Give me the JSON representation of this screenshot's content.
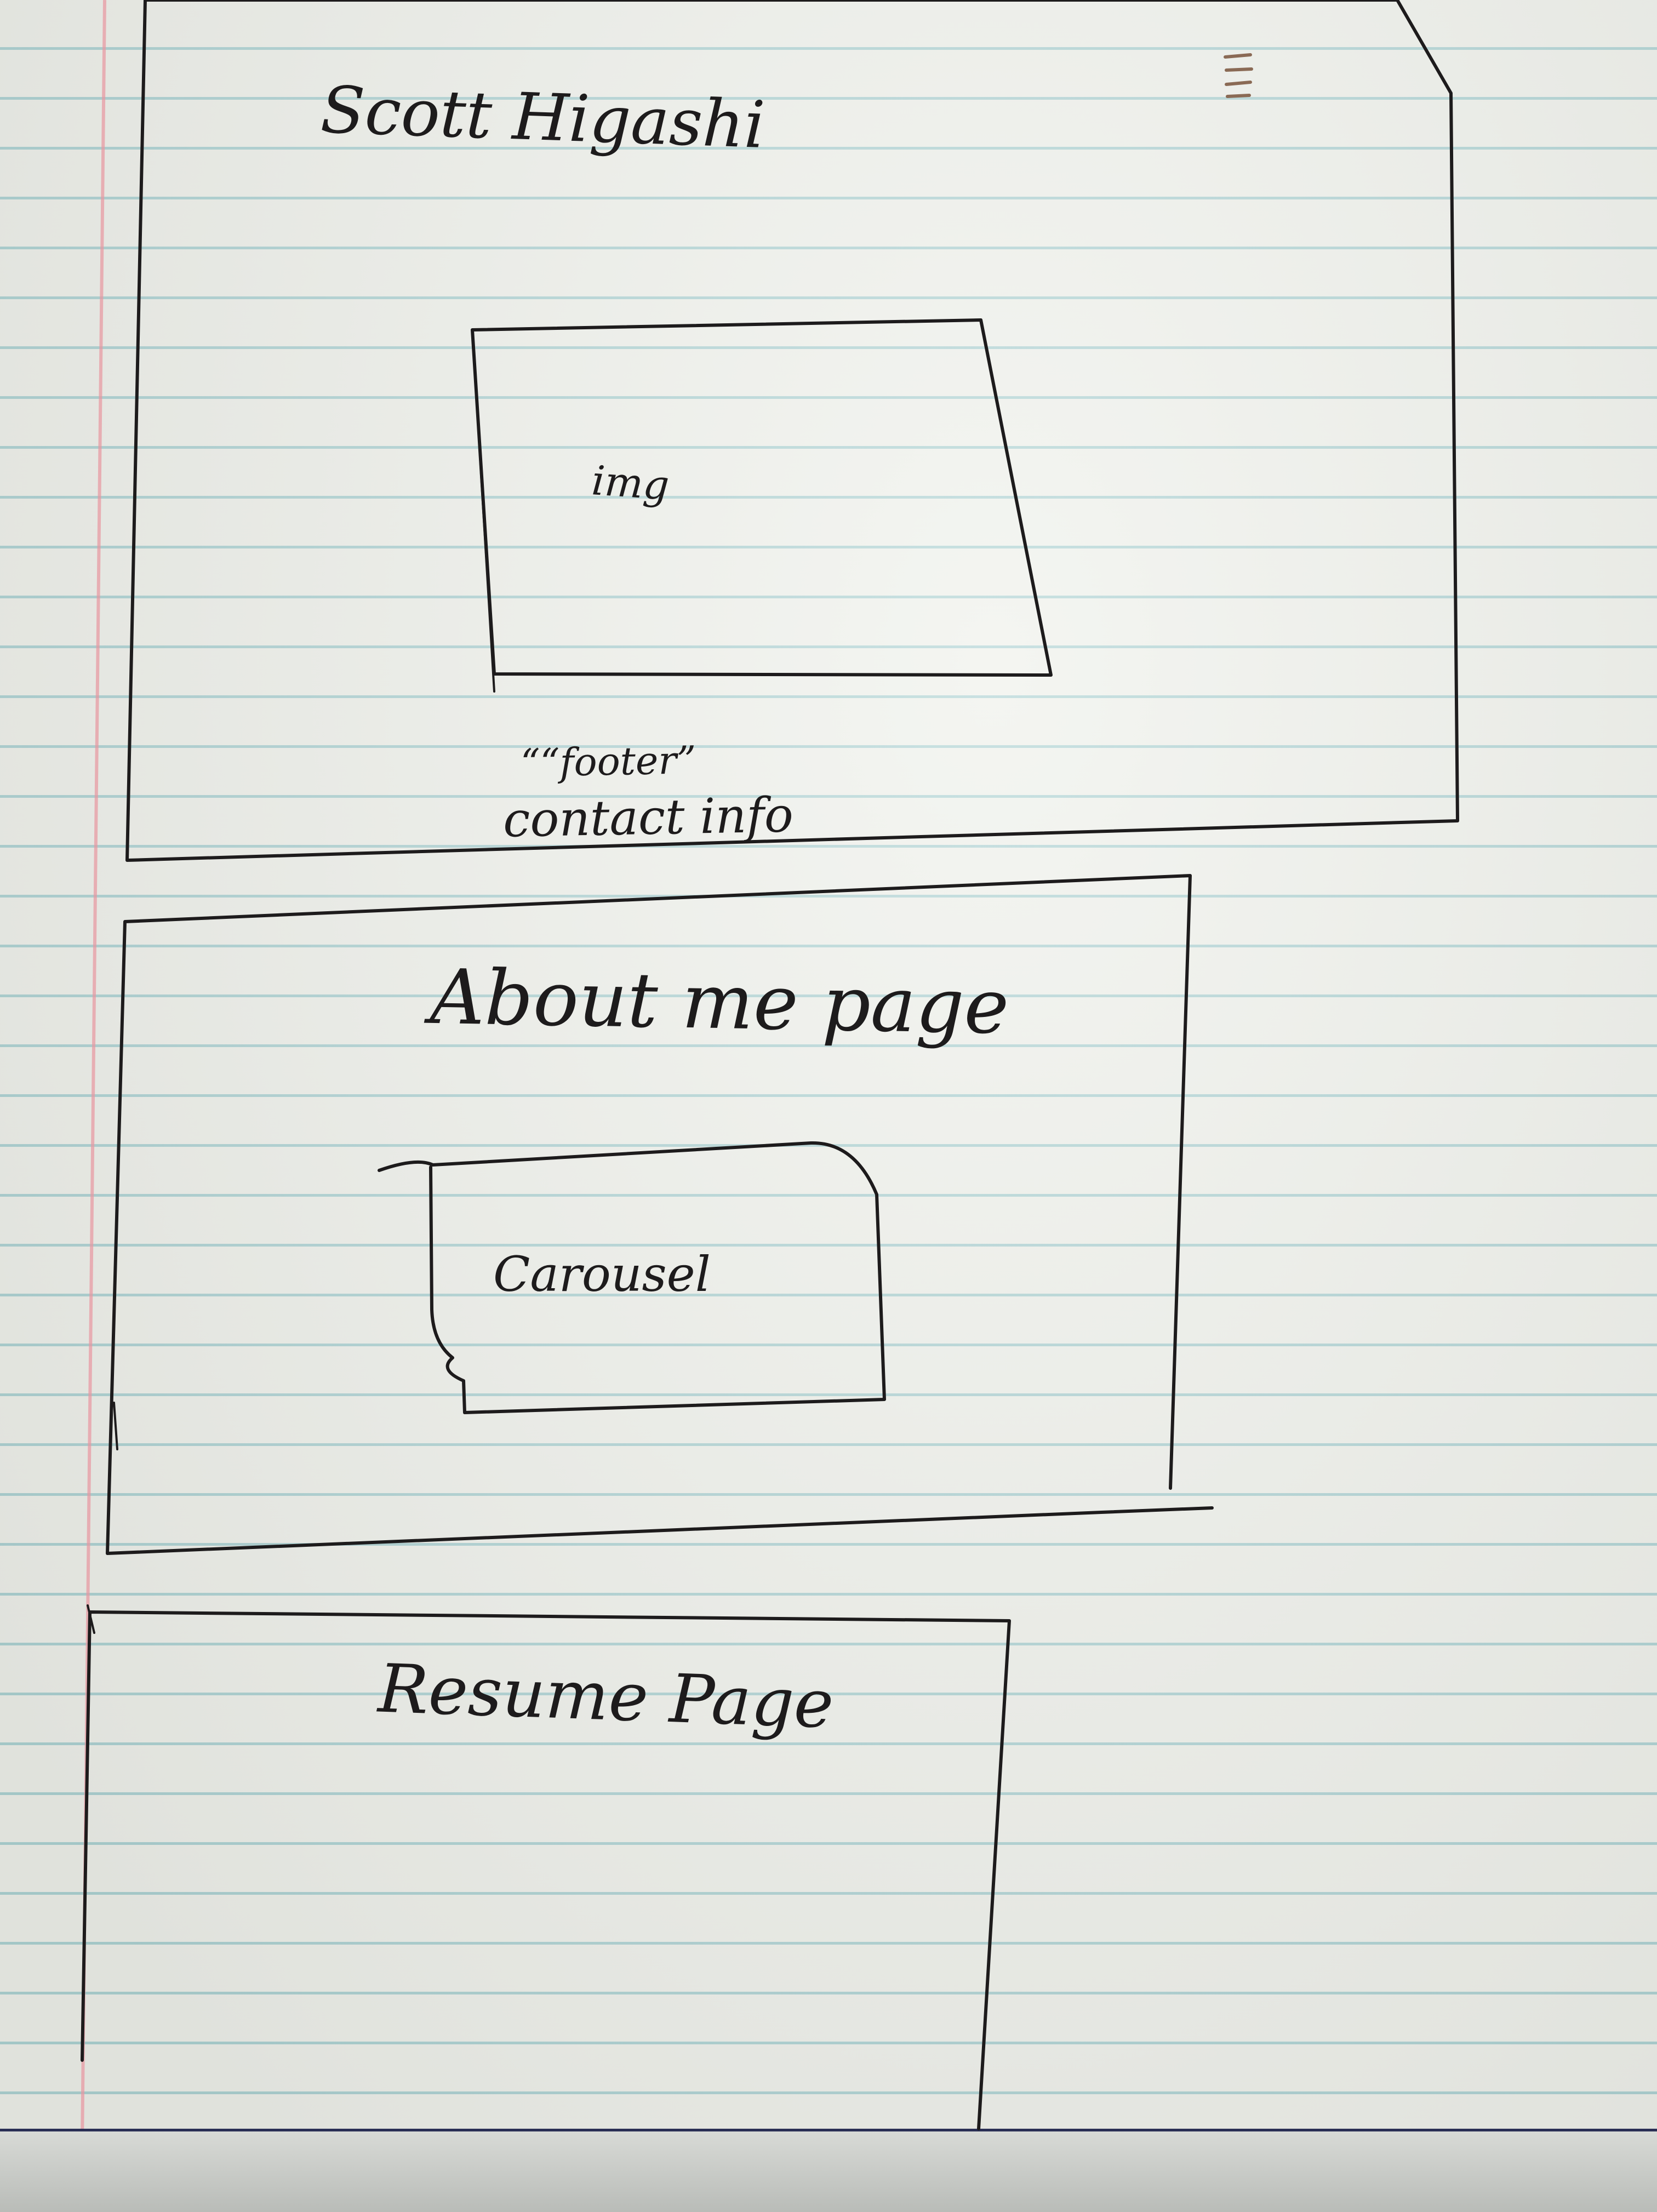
{
  "home_frame": {
    "title": "Scott Higashi",
    "menu_icon": "hamburger-menu-icon",
    "image_placeholder": "img",
    "footer_label": "““footer”",
    "footer_text": "contact info"
  },
  "about_frame": {
    "title": "About me page",
    "carousel_placeholder": "Carousel"
  },
  "resume_frame": {
    "title": "Resume Page"
  },
  "colors": {
    "ink": "#1d1b1c",
    "menu_ink": "#8a6a55",
    "paper": "#eef0ea",
    "rule_line": "#78b9be",
    "margin_line": "#e896a0"
  }
}
